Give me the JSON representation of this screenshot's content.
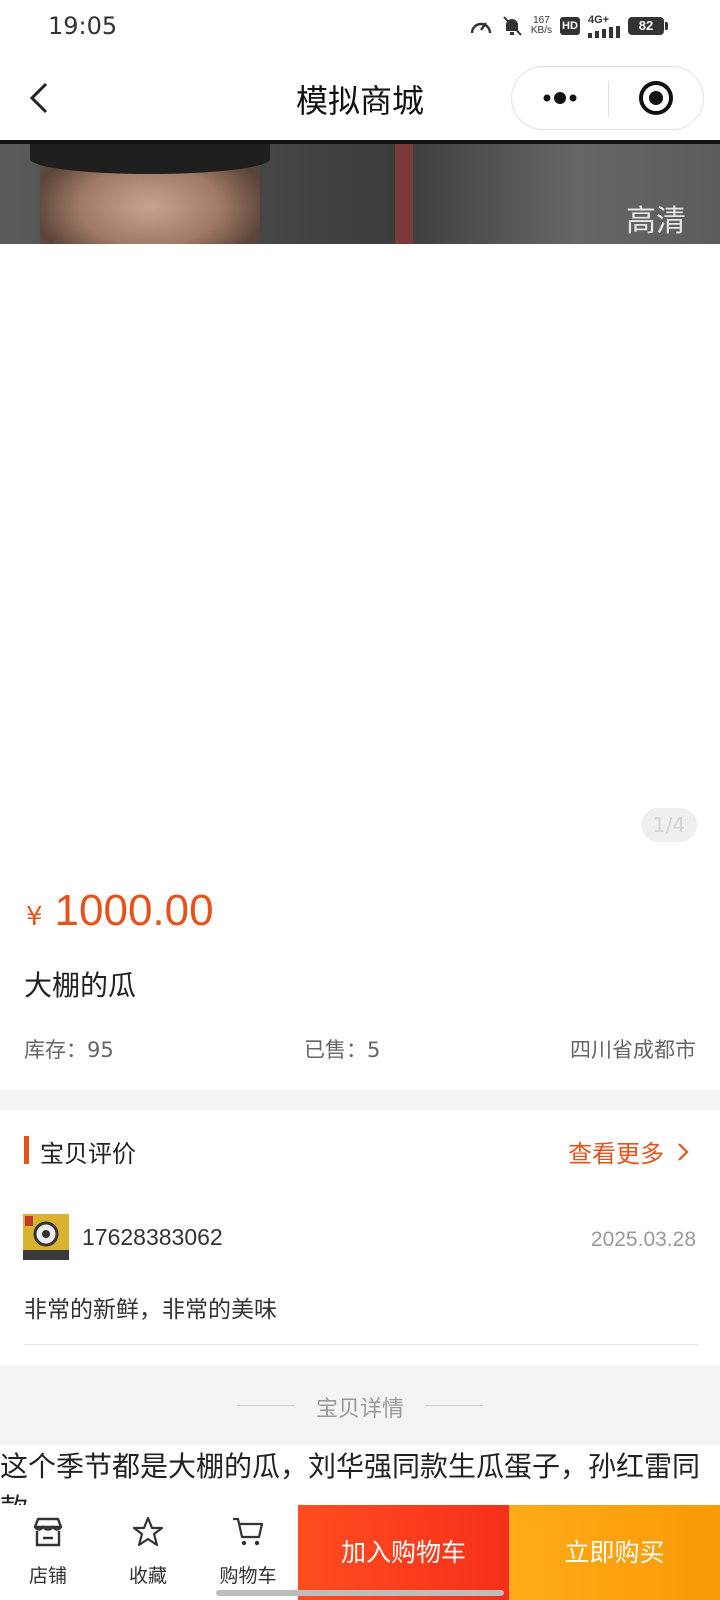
{
  "status_bar": {
    "time": "19:05",
    "net_speed_value": "167",
    "net_speed_unit": "KB/s",
    "hd_badge": "HD",
    "network_type": "4G+",
    "battery": "82"
  },
  "nav": {
    "title": "模拟商城"
  },
  "media": {
    "hd_label": "高清",
    "page_indicator": "1/4"
  },
  "product": {
    "currency_symbol": "¥",
    "price": "1000.00",
    "title": "大棚的瓜",
    "stock": "库存：95",
    "sold": "已售：5",
    "location": "四川省成都市"
  },
  "reviews": {
    "section_title": "宝贝评价",
    "see_more": "查看更多",
    "items": [
      {
        "user": "17628383062",
        "date": "2025.03.28",
        "content": "非常的新鲜，非常的美味"
      }
    ]
  },
  "details": {
    "section_title": "宝贝详情",
    "description": "这个季节都是大棚的瓜，刘华强同款生瓜蛋子，孙红雷同款"
  },
  "bottom_bar": {
    "shop_label": "店铺",
    "favorite_label": "收藏",
    "cart_label": "购物车",
    "add_to_cart": "加入购物车",
    "buy_now": "立即购买"
  },
  "colors": {
    "accent": "#e5531a",
    "add_to_cart_bg": "#f5301a",
    "buy_now_bg": "#f99a07"
  }
}
